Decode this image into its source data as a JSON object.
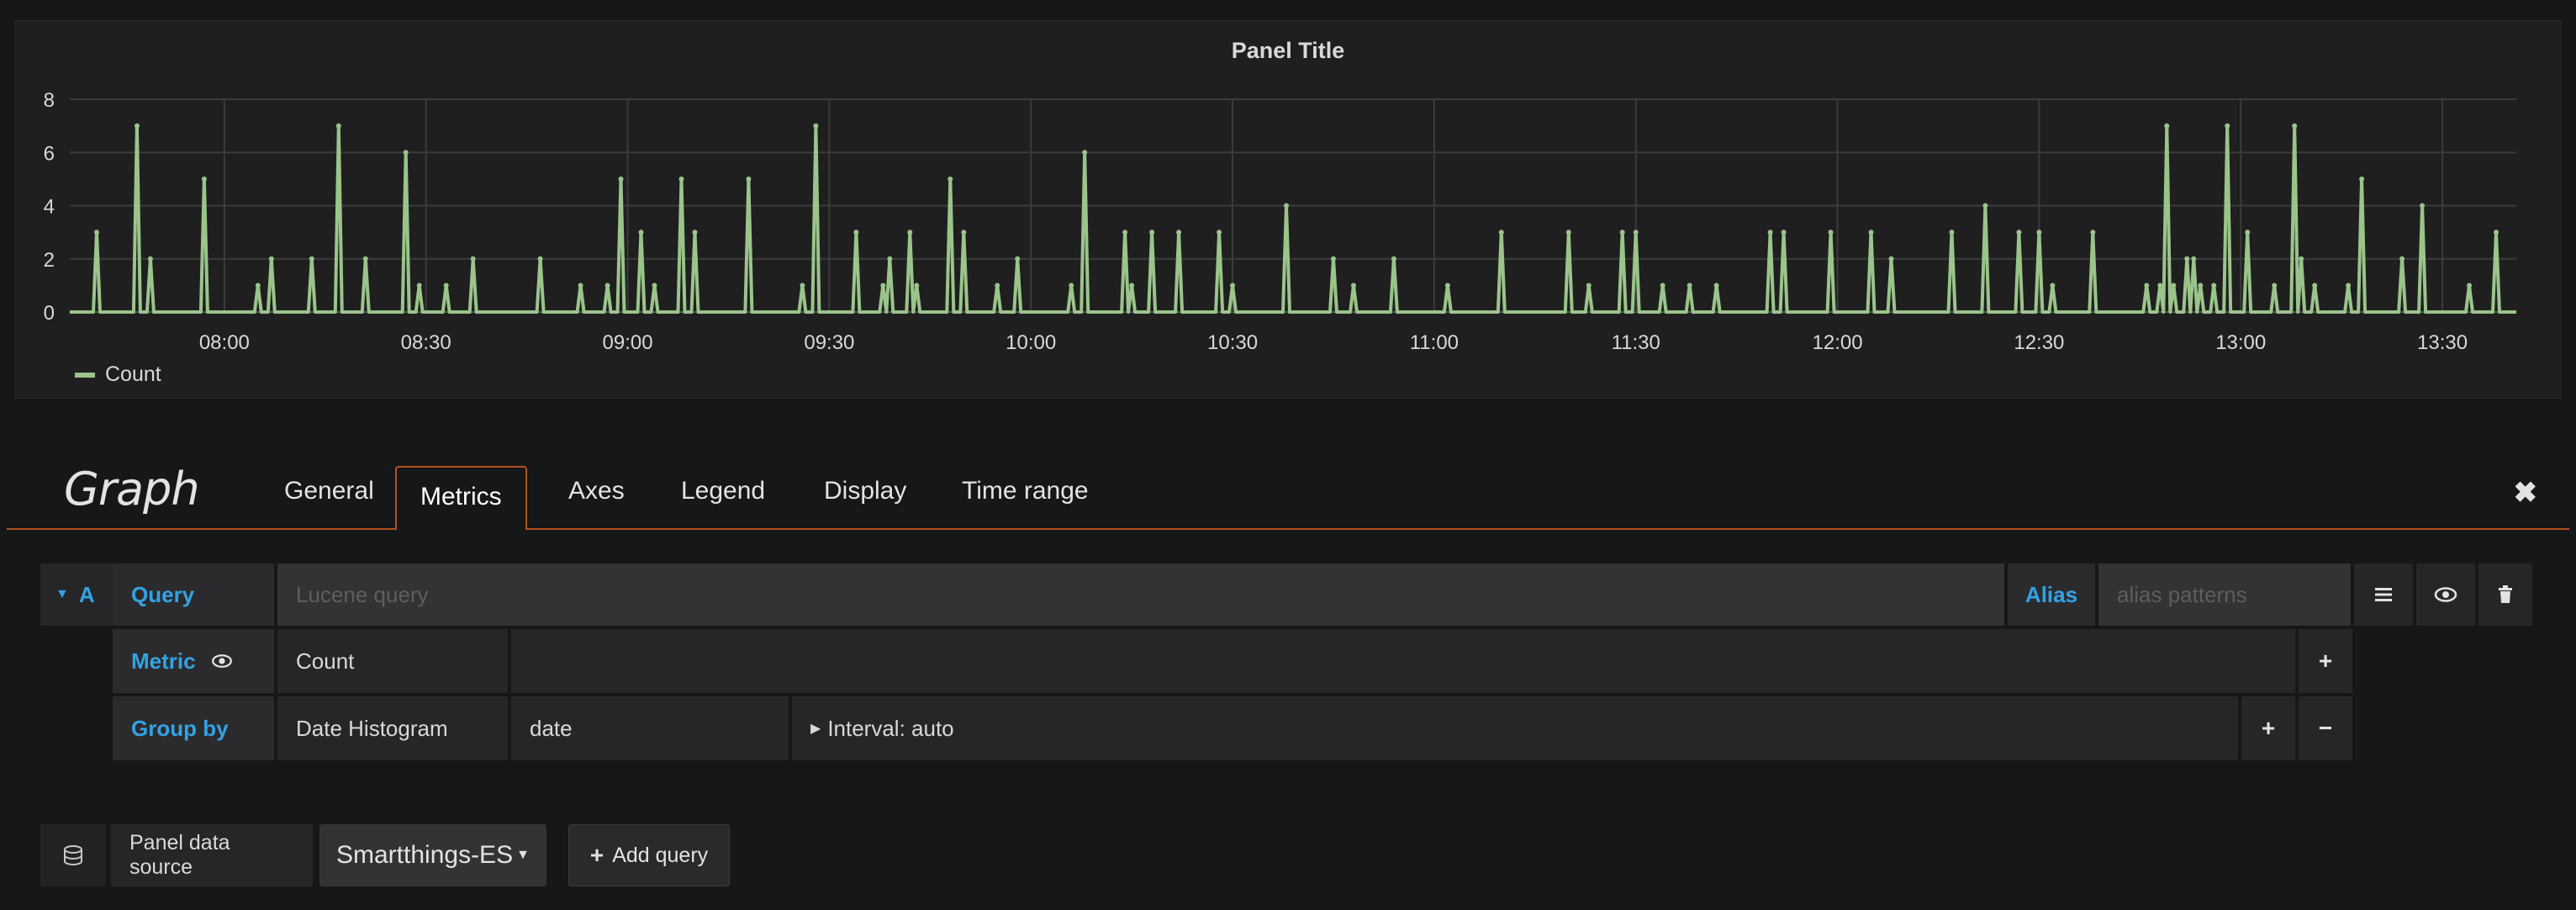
{
  "panel": {
    "title": "Panel Title"
  },
  "chart_data": {
    "type": "line",
    "ylim": [
      0,
      8
    ],
    "y_ticks": [
      0,
      2,
      4,
      6,
      8
    ],
    "x_ticks": [
      "08:00",
      "08:30",
      "09:00",
      "09:30",
      "10:00",
      "10:30",
      "11:00",
      "11:30",
      "12:00",
      "12:30",
      "13:00",
      "13:30"
    ],
    "grid": true,
    "legend_position": "bottom-left",
    "series": [
      {
        "name": "Count",
        "color": "#9ac48a",
        "points": [
          [
            "07:41",
            3
          ],
          [
            "07:47",
            7
          ],
          [
            "07:49",
            2
          ],
          [
            "07:57",
            5
          ],
          [
            "08:05",
            1
          ],
          [
            "08:07",
            2
          ],
          [
            "08:13",
            2
          ],
          [
            "08:17",
            7
          ],
          [
            "08:21",
            2
          ],
          [
            "08:27",
            6
          ],
          [
            "08:29",
            1
          ],
          [
            "08:33",
            1
          ],
          [
            "08:37",
            2
          ],
          [
            "08:47",
            2
          ],
          [
            "08:53",
            1
          ],
          [
            "08:57",
            1
          ],
          [
            "08:59",
            5
          ],
          [
            "09:02",
            3
          ],
          [
            "09:04",
            1
          ],
          [
            "09:08",
            5
          ],
          [
            "09:10",
            3
          ],
          [
            "09:18",
            5
          ],
          [
            "09:26",
            1
          ],
          [
            "09:28",
            7
          ],
          [
            "09:34",
            3
          ],
          [
            "09:38",
            1
          ],
          [
            "09:39",
            2
          ],
          [
            "09:42",
            3
          ],
          [
            "09:43",
            1
          ],
          [
            "09:48",
            5
          ],
          [
            "09:50",
            3
          ],
          [
            "09:55",
            1
          ],
          [
            "09:58",
            2
          ],
          [
            "10:06",
            1
          ],
          [
            "10:08",
            6
          ],
          [
            "10:14",
            3
          ],
          [
            "10:15",
            1
          ],
          [
            "10:18",
            3
          ],
          [
            "10:22",
            3
          ],
          [
            "10:28",
            3
          ],
          [
            "10:30",
            1
          ],
          [
            "10:38",
            4
          ],
          [
            "10:45",
            2
          ],
          [
            "10:48",
            1
          ],
          [
            "10:54",
            2
          ],
          [
            "11:02",
            1
          ],
          [
            "11:10",
            3
          ],
          [
            "11:20",
            3
          ],
          [
            "11:23",
            1
          ],
          [
            "11:28",
            3
          ],
          [
            "11:30",
            3
          ],
          [
            "11:34",
            1
          ],
          [
            "11:38",
            1
          ],
          [
            "11:42",
            1
          ],
          [
            "11:50",
            3
          ],
          [
            "11:52",
            3
          ],
          [
            "11:59",
            3
          ],
          [
            "12:05",
            3
          ],
          [
            "12:08",
            2
          ],
          [
            "12:17",
            3
          ],
          [
            "12:22",
            4
          ],
          [
            "12:27",
            3
          ],
          [
            "12:30",
            3
          ],
          [
            "12:32",
            1
          ],
          [
            "12:38",
            3
          ],
          [
            "12:46",
            1
          ],
          [
            "12:48",
            1
          ],
          [
            "12:49",
            7
          ],
          [
            "12:50",
            1
          ],
          [
            "12:52",
            2
          ],
          [
            "12:53",
            2
          ],
          [
            "12:54",
            1
          ],
          [
            "12:56",
            1
          ],
          [
            "12:58",
            7
          ],
          [
            "13:01",
            3
          ],
          [
            "13:05",
            1
          ],
          [
            "13:08",
            7
          ],
          [
            "13:09",
            2
          ],
          [
            "13:11",
            1
          ],
          [
            "13:16",
            1
          ],
          [
            "13:18",
            5
          ],
          [
            "13:24",
            2
          ],
          [
            "13:27",
            4
          ],
          [
            "13:34",
            1
          ],
          [
            "13:38",
            3
          ]
        ]
      }
    ]
  },
  "editor": {
    "title": "Graph",
    "tabs": [
      "General",
      "Metrics",
      "Axes",
      "Legend",
      "Display",
      "Time range"
    ],
    "active_tab": "Metrics",
    "close_icon": "close-icon"
  },
  "query": {
    "ref_id": "A",
    "query_label": "Query",
    "query_placeholder": "Lucene query",
    "alias_label": "Alias",
    "alias_placeholder": "alias patterns",
    "metric_label": "Metric",
    "metric_value": "Count",
    "group_by_label": "Group by",
    "group_by_type": "Date Histogram",
    "group_by_field": "date",
    "interval": "Interval: auto"
  },
  "footer": {
    "datasource_label": "Panel data source",
    "datasource_value": "Smartthings-ES",
    "add_query_label": "Add query"
  }
}
